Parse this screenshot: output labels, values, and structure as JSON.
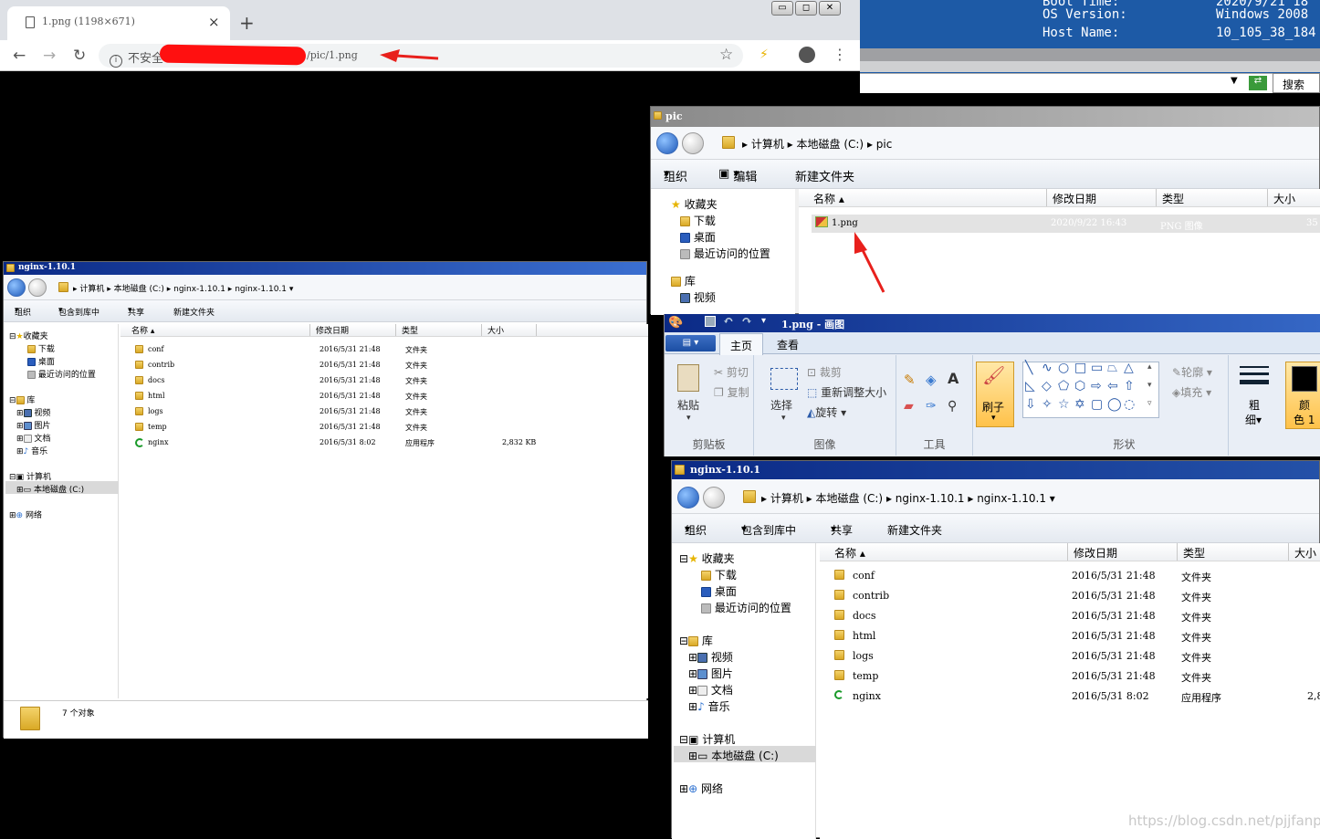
{
  "chrome": {
    "tab_title": "1.png (1198×671)",
    "tab_close": "×",
    "new_tab": "+",
    "insecure_label": "不安全",
    "url_tail": "/pic/1.png",
    "buttons": {
      "min": "▭",
      "max": "◻",
      "close": "✕"
    }
  },
  "console": {
    "rows": [
      {
        "label": "Boot Time:",
        "value": "2020/9/21 18"
      },
      {
        "label": "OS Version:",
        "value": "Windows 2008"
      },
      {
        "label": "Host Name:",
        "value": "10_105_38_184"
      }
    ],
    "search_label": "搜索 ng"
  },
  "pic_window": {
    "title": "pic",
    "breadcrumb": [
      "计算机",
      "本地磁盘 (C:)",
      "pic"
    ],
    "commands": {
      "organize": "组织",
      "edit": "编辑",
      "new_folder": "新建文件夹"
    },
    "tree": [
      {
        "label": "收藏夹"
      },
      {
        "label": "下载"
      },
      {
        "label": "桌面"
      },
      {
        "label": "最近访问的位置"
      },
      {
        "label": "库"
      },
      {
        "label": "视频"
      }
    ],
    "columns": [
      "名称",
      "修改日期",
      "类型",
      "大小"
    ],
    "files": [
      {
        "name": "1.png",
        "date": "2020/9/22 16:43",
        "type": "PNG 图像",
        "size": "35"
      }
    ]
  },
  "left_explorer": {
    "title": "nginx-1.10.1",
    "breadcrumb": [
      "计算机",
      "本地磁盘 (C:)",
      "nginx-1.10.1",
      "nginx-1.10.1"
    ],
    "commands": {
      "organize": "组织",
      "include": "包含到库中",
      "share": "共享",
      "new_folder": "新建文件夹"
    },
    "tree": [
      {
        "label": "收藏夹",
        "exp": "⊟"
      },
      {
        "label": "下载"
      },
      {
        "label": "桌面"
      },
      {
        "label": "最近访问的位置"
      },
      {
        "label": "库",
        "exp": "⊟"
      },
      {
        "label": "视频",
        "exp": "⊞"
      },
      {
        "label": "图片",
        "exp": "⊞"
      },
      {
        "label": "文档",
        "exp": "⊞"
      },
      {
        "label": "音乐",
        "exp": "⊞"
      },
      {
        "label": "计算机",
        "exp": "⊟"
      },
      {
        "label": "本地磁盘 (C:)",
        "exp": "⊞"
      },
      {
        "label": "网络",
        "exp": "⊞"
      }
    ],
    "columns": [
      "名称",
      "修改日期",
      "类型",
      "大小"
    ],
    "files": [
      {
        "name": "conf",
        "date": "2016/5/31 21:48",
        "type": "文件夹",
        "size": ""
      },
      {
        "name": "contrib",
        "date": "2016/5/31 21:48",
        "type": "文件夹",
        "size": ""
      },
      {
        "name": "docs",
        "date": "2016/5/31 21:48",
        "type": "文件夹",
        "size": ""
      },
      {
        "name": "html",
        "date": "2016/5/31 21:48",
        "type": "文件夹",
        "size": ""
      },
      {
        "name": "logs",
        "date": "2016/5/31 21:48",
        "type": "文件夹",
        "size": ""
      },
      {
        "name": "temp",
        "date": "2016/5/31 21:48",
        "type": "文件夹",
        "size": ""
      },
      {
        "name": "nginx",
        "date": "2016/5/31 8:02",
        "type": "应用程序",
        "size": "2,832 KB"
      }
    ],
    "status": "7 个对象"
  },
  "paint": {
    "title": "1.png - 画图",
    "tabs": {
      "home": "主页",
      "view": "查看"
    },
    "clipboard": {
      "paste": "粘贴",
      "cut": "剪切",
      "copy": "复制",
      "group": "剪贴板"
    },
    "image": {
      "select": "选择",
      "crop": "裁剪",
      "resize": "重新调整大小",
      "rotate": "旋转",
      "group": "图像"
    },
    "tools": {
      "group": "工具",
      "brush": "刷子"
    },
    "shapes": {
      "outline": "轮廓",
      "fill": "填充",
      "group": "形状"
    },
    "size": {
      "label1": "粗",
      "label2": "细"
    },
    "color": {
      "label1": "颜",
      "label2": "色 1"
    }
  },
  "right_explorer": {
    "title": "nginx-1.10.1",
    "breadcrumb": [
      "计算机",
      "本地磁盘 (C:)",
      "nginx-1.10.1",
      "nginx-1.10.1"
    ],
    "commands": {
      "organize": "组织",
      "include": "包含到库中",
      "share": "共享",
      "new_folder": "新建文件夹"
    },
    "tree": [
      {
        "label": "收藏夹",
        "exp": "⊟"
      },
      {
        "label": "下载"
      },
      {
        "label": "桌面"
      },
      {
        "label": "最近访问的位置"
      },
      {
        "label": "库",
        "exp": "⊟"
      },
      {
        "label": "视频",
        "exp": "⊞"
      },
      {
        "label": "图片",
        "exp": "⊞"
      },
      {
        "label": "文档",
        "exp": "⊞"
      },
      {
        "label": "音乐",
        "exp": "⊞"
      },
      {
        "label": "计算机",
        "exp": "⊟"
      },
      {
        "label": "本地磁盘 (C:)",
        "exp": "⊞"
      },
      {
        "label": "网络",
        "exp": "⊞"
      }
    ],
    "columns": [
      "名称",
      "修改日期",
      "类型",
      "大小"
    ],
    "files": [
      {
        "name": "conf",
        "date": "2016/5/31 21:48",
        "type": "文件夹",
        "size": ""
      },
      {
        "name": "contrib",
        "date": "2016/5/31 21:48",
        "type": "文件夹",
        "size": ""
      },
      {
        "name": "docs",
        "date": "2016/5/31 21:48",
        "type": "文件夹",
        "size": ""
      },
      {
        "name": "html",
        "date": "2016/5/31 21:48",
        "type": "文件夹",
        "size": ""
      },
      {
        "name": "logs",
        "date": "2016/5/31 21:48",
        "type": "文件夹",
        "size": ""
      },
      {
        "name": "temp",
        "date": "2016/5/31 21:48",
        "type": "文件夹",
        "size": ""
      },
      {
        "name": "nginx",
        "date": "2016/5/31 8:02",
        "type": "应用程序",
        "size": "2,8"
      }
    ]
  },
  "watermark": "https://blog.csdn.net/pjjfanpu"
}
